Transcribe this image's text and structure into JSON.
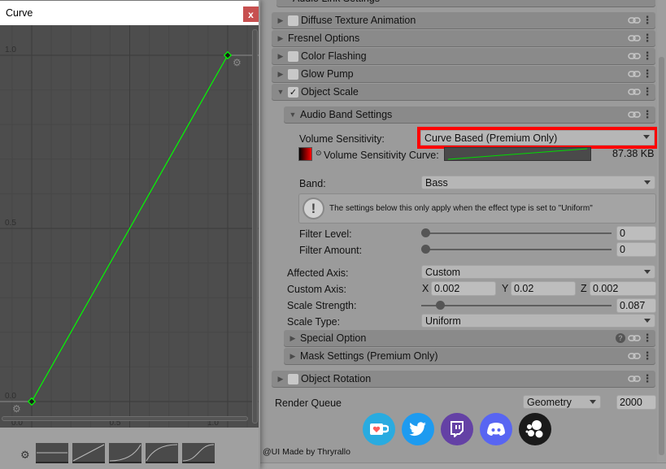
{
  "curve_window": {
    "title": "Curve",
    "close_label": "x",
    "y_ticks": [
      "1.0",
      "0.5",
      "0.0"
    ],
    "x_ticks": [
      "0.0",
      "0.5",
      "1.0"
    ],
    "curve": {
      "color": "#00ff00",
      "keys": [
        {
          "x": 0.0,
          "y": 0.0
        },
        {
          "x": 1.0,
          "y": 1.0
        }
      ]
    },
    "presets": [
      "constant",
      "linear",
      "ease-in",
      "ease-out",
      "ease-in-out"
    ]
  },
  "inspector": {
    "top_partial_header": "Audio Link Settings",
    "sections": [
      {
        "label": "Diffuse Texture Animation",
        "has_checkbox": true,
        "checked": false,
        "expanded": false
      },
      {
        "label": "Fresnel Options",
        "has_checkbox": false,
        "checked": false,
        "expanded": false
      },
      {
        "label": "Color Flashing",
        "has_checkbox": true,
        "checked": false,
        "expanded": false
      },
      {
        "label": "Glow Pump",
        "has_checkbox": true,
        "checked": false,
        "expanded": false
      },
      {
        "label": "Object Scale",
        "has_checkbox": true,
        "checked": true,
        "expanded": true
      }
    ],
    "audio_band": {
      "header": "Audio Band Settings",
      "volume_sensitivity_label": "Volume Sensitivity:",
      "volume_sensitivity_value": "Curve Based (Premium Only)",
      "highlight_color": "#ff0000",
      "curve_label": "Volume Sensitivity Curve:",
      "curve_size": "87.38 KB",
      "band_label": "Band:",
      "band_value": "Bass",
      "info_text": "The settings below this only apply when the effect type is set to \"Uniform\"",
      "filter_level_label": "Filter Level:",
      "filter_level_value": "0",
      "filter_amount_label": "Filter Amount:",
      "filter_amount_value": "0"
    },
    "object_scale": {
      "affected_axis_label": "Affected Axis:",
      "affected_axis_value": "Custom",
      "custom_axis_label": "Custom Axis:",
      "x_label": "X",
      "x_value": "0.002",
      "y_label": "Y",
      "y_value": "0.02",
      "z_label": "Z",
      "z_value": "0.002",
      "scale_strength_label": "Scale Strength:",
      "scale_strength_value": "0.087",
      "scale_strength_fraction": 0.087,
      "scale_type_label": "Scale Type:",
      "scale_type_value": "Uniform",
      "special_option": "Special Option",
      "mask_settings": "Mask Settings (Premium Only)"
    },
    "object_rotation": "Object Rotation",
    "render_queue_label": "Render Queue",
    "render_queue_mode": "Geometry",
    "render_queue_value": "2000",
    "social_icons": [
      {
        "name": "ko-fi",
        "color": "#29abe0"
      },
      {
        "name": "twitter",
        "color": "#1d9bf0"
      },
      {
        "name": "twitch",
        "color": "#6441a5"
      },
      {
        "name": "discord",
        "color": "#5865f2"
      },
      {
        "name": "thry",
        "color": "#1a1a1a"
      }
    ],
    "credit": "@UI Made by Thryrallo"
  }
}
